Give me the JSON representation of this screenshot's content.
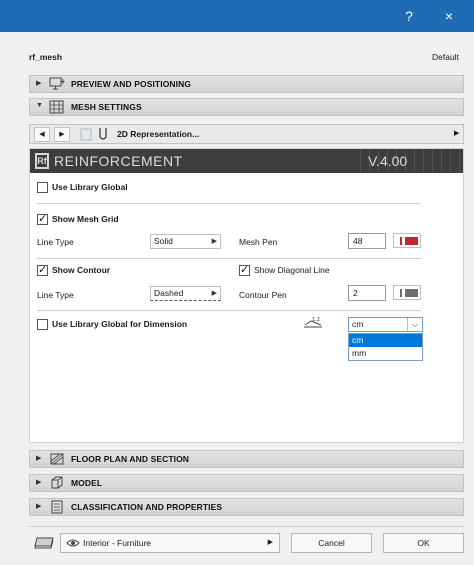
{
  "window": {
    "help_label": "?",
    "close_label": "×"
  },
  "header": {
    "object_name": "rf_mesh",
    "right_label": "Default"
  },
  "sections": {
    "preview": {
      "label": "PREVIEW AND POSITIONING",
      "icon": "preview-icon"
    },
    "mesh": {
      "label": "MESH SETTINGS",
      "icon": "mesh-settings-icon"
    },
    "floor": {
      "label": "FLOOR PLAN AND SECTION",
      "icon": "floor-plan-icon"
    },
    "model": {
      "label": "MODEL",
      "icon": "model-icon"
    },
    "classification": {
      "label": "CLASSIFICATION AND PROPERTIES",
      "icon": "classification-icon"
    }
  },
  "nav": {
    "page_title": "2D Representation..."
  },
  "panel": {
    "title": "REINFORCEMENT",
    "version": "V.4.00",
    "logo": "Rf",
    "use_library_global": {
      "label": "Use Library Global",
      "checked": false
    },
    "show_mesh_grid": {
      "label": "Show Mesh Grid",
      "checked": true
    },
    "mesh_line_type_label": "Line Type",
    "mesh_line_type_value": "Solid",
    "mesh_pen_label": "Mesh Pen",
    "mesh_pen_value": "48",
    "mesh_pen_color": "#c0272d",
    "show_contour": {
      "label": "Show Contour",
      "checked": true
    },
    "show_diagonal": {
      "label": "Show Diagonal Line",
      "checked": true
    },
    "contour_line_type_label": "Line Type",
    "contour_line_type_value": "Dashed",
    "contour_pen_label": "Contour Pen",
    "contour_pen_value": "2",
    "contour_pen_color": "#6e6e6e",
    "dimension_global": {
      "label": "Use Library Global for Dimension",
      "checked": false
    },
    "unit_value": "cm",
    "unit_options": [
      "cm",
      "mm"
    ],
    "unit_selected_index": 0
  },
  "footer": {
    "layer_label": "Interior - Furniture",
    "cancel_label": "Cancel",
    "ok_label": "OK"
  },
  "colors": {
    "titlebar": "#1c6bb3",
    "selection": "#0078d7"
  }
}
